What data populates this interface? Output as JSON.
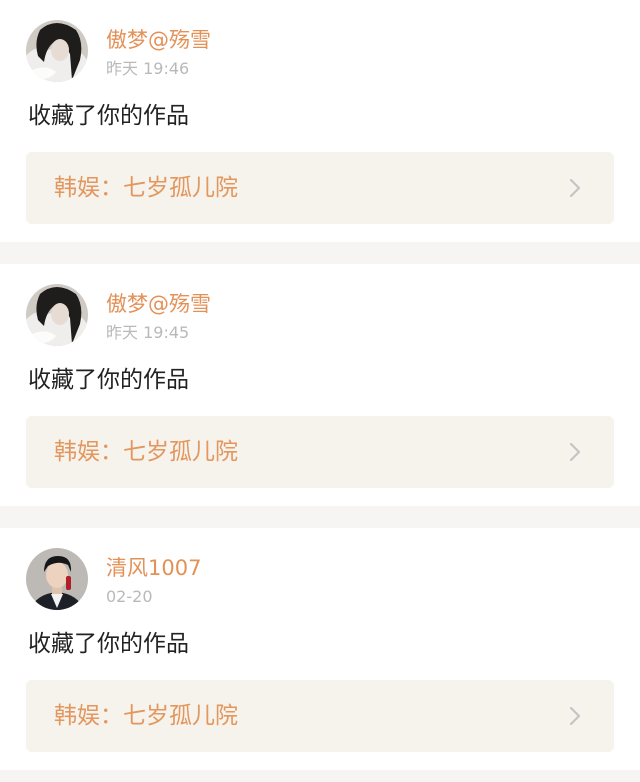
{
  "notifications": [
    {
      "username": "傲梦@殇雪",
      "time": "昨天 19:46",
      "action": "收藏了你的作品",
      "work_title": "韩娱：七岁孤儿院",
      "avatar_icon": "avatar-girl-icon"
    },
    {
      "username": "傲梦@殇雪",
      "time": "昨天 19:45",
      "action": "收藏了你的作品",
      "work_title": "韩娱：七岁孤儿院",
      "avatar_icon": "avatar-girl-icon"
    },
    {
      "username": "清风1007",
      "time": "02-20",
      "action": "收藏了你的作品",
      "work_title": "韩娱：七岁孤儿院",
      "avatar_icon": "avatar-man-icon"
    }
  ],
  "colors": {
    "username": "#e49157",
    "work_title": "#e3965e",
    "link_bg": "#f5f3ec",
    "separator": "#f6f5f4",
    "chevron": "#c4c4c4"
  },
  "icons": {
    "chevron": "chevron-right-icon"
  }
}
